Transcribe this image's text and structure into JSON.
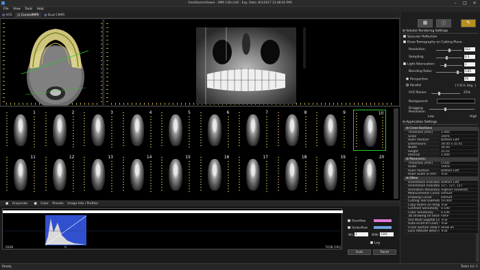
{
  "window": {
    "title": "OneVolumeViewer - [MM 136×140 - Exp. Date: 8/1/2017 12:48:02 PM]"
  },
  "menu": {
    "items": [
      "File",
      "View",
      "Tools",
      "Help"
    ]
  },
  "tabs": [
    {
      "label": "XYZ"
    },
    {
      "label": "CurvedMPR"
    },
    {
      "label": "Dual CMPR"
    }
  ],
  "slices": {
    "row1": [
      "1",
      "2",
      "3",
      "4",
      "5",
      "6",
      "7",
      "8",
      "9",
      "10"
    ],
    "row2": [
      "11",
      "12",
      "13",
      "14",
      "15",
      "16",
      "17",
      "18",
      "19",
      "20"
    ],
    "selected": "10"
  },
  "bottom_tabs": [
    "Grayscale",
    "Color",
    "Presets",
    "Image Info / Profiles"
  ],
  "histogram": {
    "min_label": "-1648",
    "zero_label": "0",
    "max_label": "7438 [HU]",
    "overflow_label": "Overflow",
    "underflow_label": "Underflow",
    "wl_label": "WL:",
    "wl_value": "3",
    "ww_label": "WW:",
    "ww_value": "1361",
    "log_label": "Log",
    "auto_label": "Auto",
    "reset_label": "Reset"
  },
  "right_panel": {
    "volume_rendering_title": "Volume Rendering Settings",
    "specular_reflection": "Specular Reflection",
    "draw_tomography": "Draw Tomography on Cutting Plane",
    "resolution_label": "Resolution:",
    "resolution_value": "512",
    "sampling_label": "Sampling:",
    "sampling_value": "0.3",
    "light_attenuation_label": "Light Attenuation:",
    "light_attenuation_value": "1",
    "blending_ratio_label": "Blending Ratio:",
    "blending_ratio_value": "0.85",
    "perspective_label": "Perspective",
    "perspective_value": "56",
    "parallel_label": "Parallel",
    "fov_label": "[ F.O.V. deg. ]",
    "xyz_planes_label": "XYZ Planes:",
    "xyz_planes_value": "25%",
    "background_label": "Background:",
    "dragging_resolution_label": "Dragging Resolution:",
    "low_label": "Low",
    "high_label": "High",
    "app_settings_title": "Application Settings"
  },
  "settings_groups": [
    {
      "header": "Cross-Sections",
      "rows": [
        {
          "k": "Thickness [mm]",
          "v": "1.000"
        },
        {
          "k": "Scale",
          "v": "100%"
        },
        {
          "k": "Ruler Position",
          "v": "Bottom Left"
        },
        {
          "k": "Dimensions",
          "v": "30.00 x 35.41"
        },
        {
          "k": "Width",
          "v": "30.00"
        },
        {
          "k": "Height",
          "v": "35.41"
        },
        {
          "k": "Interval",
          "v": "1.000"
        }
      ]
    },
    {
      "header": "Panoramic",
      "rows": [
        {
          "k": "Thickness [mm]",
          "v": "0.000"
        },
        {
          "k": "Scale",
          "v": "100%"
        },
        {
          "k": "Ruler Position",
          "v": "Bottom Left"
        },
        {
          "k": "Ruler Scale in mm",
          "v": "True"
        }
      ]
    },
    {
      "header": "Other",
      "rows": [
        {
          "k": "Orientation Indicator Position",
          "v": "Bottom Left"
        },
        {
          "k": "Orientation Indicator Color",
          "v": "127, 127, 127"
        },
        {
          "k": "Animation Resolution",
          "v": "Highest (Slowest)"
        },
        {
          "k": "Measurement Cursor",
          "v": "Default"
        },
        {
          "k": "Drawing Cursor",
          "v": "Default"
        },
        {
          "k": "Cutting Tool Diameter (mm)",
          "v": "10.000"
        },
        {
          "k": "Copy Rulers on Image",
          "v": "True"
        },
        {
          "k": "Contrast Sensitivity",
          "v": "0.100"
        },
        {
          "k": "Color Sensitivity",
          "v": "0.100"
        },
        {
          "k": "3D Drawing on Slices",
          "v": "False"
        },
        {
          "k": "Use Multi Sagittal Line",
          "v": "True"
        },
        {
          "k": "Auto-scroll to Cross Section",
          "v": "True"
        },
        {
          "k": "Cross Section View Mode",
          "v": "Show all"
        },
        {
          "k": "Lock Altitude when Spline",
          "v": "True"
        }
      ]
    }
  ],
  "status": {
    "left": "Ready",
    "right": "Tasks (s): 1"
  }
}
